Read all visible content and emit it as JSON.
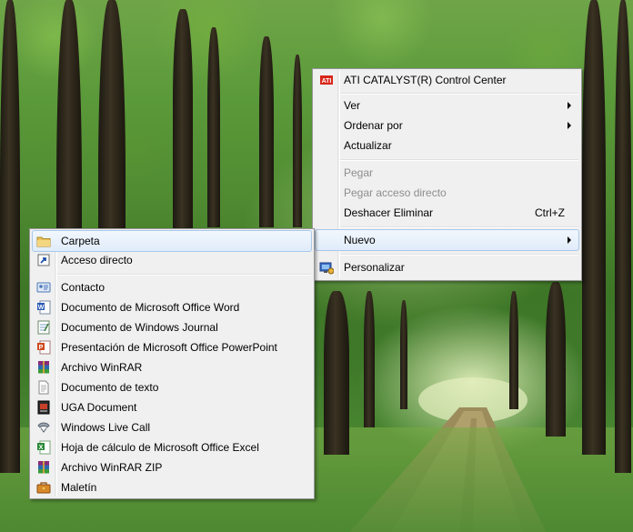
{
  "desktop_menu": {
    "items": [
      {
        "label": "ATI CATALYST(R) Control Center",
        "icon": "ati-icon"
      },
      {
        "label": "Ver",
        "submenu": true
      },
      {
        "label": "Ordenar por",
        "submenu": true
      },
      {
        "label": "Actualizar"
      },
      {
        "label": "Pegar",
        "disabled": true
      },
      {
        "label": "Pegar acceso directo",
        "disabled": true
      },
      {
        "label": "Deshacer Eliminar",
        "shortcut": "Ctrl+Z"
      },
      {
        "label": "Nuevo",
        "submenu": true,
        "highlighted": true
      },
      {
        "label": "Personalizar",
        "icon": "personalize-icon"
      }
    ]
  },
  "new_submenu": {
    "items": [
      {
        "label": "Carpeta",
        "icon": "folder-icon",
        "highlighted": true
      },
      {
        "label": "Acceso directo",
        "icon": "shortcut-icon"
      },
      {
        "label": "Contacto",
        "icon": "contact-icon"
      },
      {
        "label": "Documento de Microsoft Office Word",
        "icon": "word-document-icon"
      },
      {
        "label": "Documento de Windows Journal",
        "icon": "journal-icon"
      },
      {
        "label": "Presentación de Microsoft Office PowerPoint",
        "icon": "powerpoint-icon"
      },
      {
        "label": "Archivo WinRAR",
        "icon": "winrar-icon"
      },
      {
        "label": "Documento de texto",
        "icon": "text-document-icon"
      },
      {
        "label": "UGA Document",
        "icon": "uga-document-icon"
      },
      {
        "label": "Windows Live Call",
        "icon": "phone-call-icon"
      },
      {
        "label": "Hoja de cálculo de Microsoft Office Excel",
        "icon": "excel-icon"
      },
      {
        "label": "Archivo WinRAR ZIP",
        "icon": "winrar-zip-icon"
      },
      {
        "label": "Maletín",
        "icon": "briefcase-icon"
      }
    ]
  },
  "colors": {
    "menu_background": "#f0f0f0",
    "menu_border": "#979797",
    "highlight_border": "#a8c8ea",
    "disabled_text": "#8d8d8d"
  }
}
